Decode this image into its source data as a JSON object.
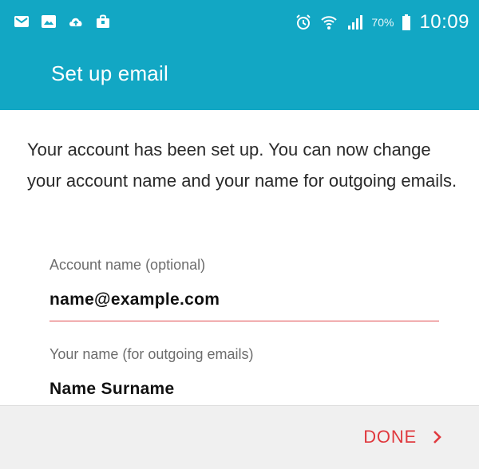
{
  "colors": {
    "accent": "#12a7c4",
    "done": "#e0393e",
    "field_underline_active": "#e04a4e"
  },
  "status_bar": {
    "left_icons": [
      "email-icon",
      "image-icon",
      "cloud-upload-icon",
      "shopping-bag-icon"
    ],
    "right_icons": [
      "alarm-icon",
      "wifi-icon",
      "signal-icon",
      "battery-icon"
    ],
    "battery": "70%",
    "time": "10:09"
  },
  "app_bar": {
    "title": "Set up email"
  },
  "content": {
    "description": "Your account has been set up. You can now change your account name and your name for outgoing emails.",
    "account_name": {
      "label": "Account name (optional)",
      "value": "name@example.com"
    },
    "your_name": {
      "label": "Your name (for outgoing emails)",
      "value": "Name Surname"
    }
  },
  "footer": {
    "done_label": "DONE",
    "done_icon": "chevron-right-icon"
  }
}
